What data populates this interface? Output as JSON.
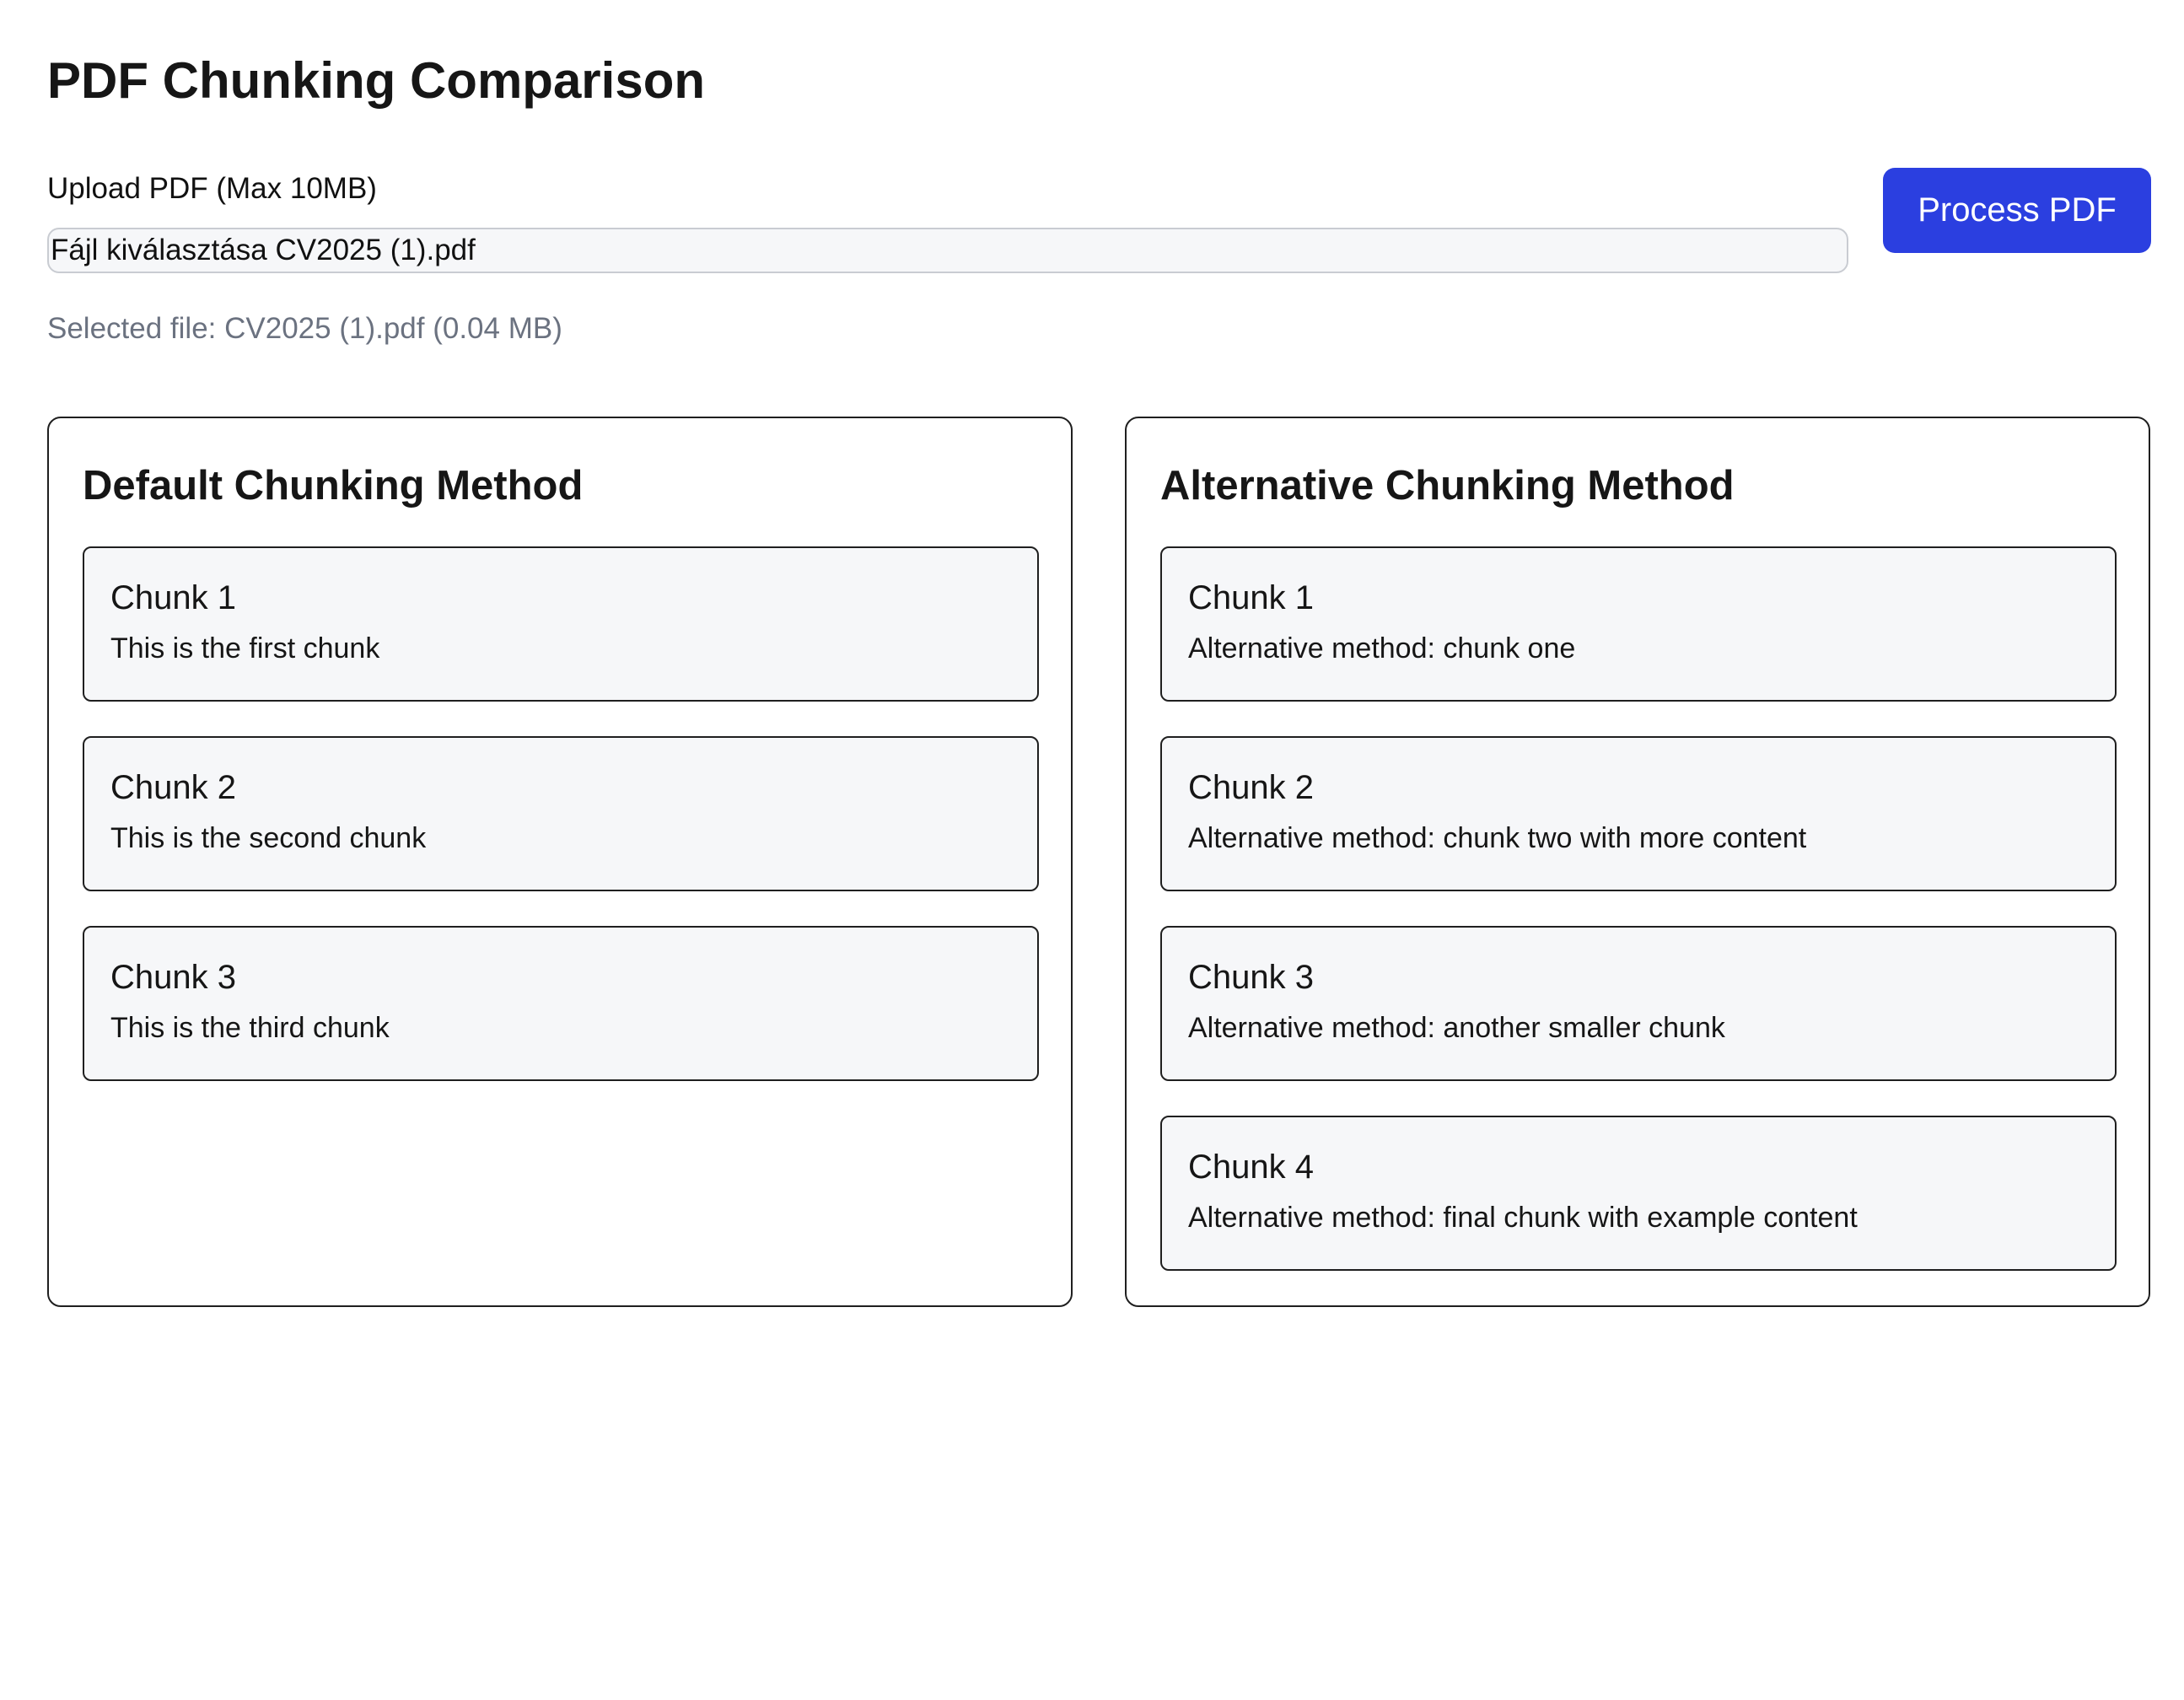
{
  "header": {
    "title": "PDF Chunking Comparison"
  },
  "upload": {
    "label": "Upload PDF (Max 10MB)",
    "file_input_text": "Fájl kiválasztása CV2025 (1).pdf",
    "selected_file_text": "Selected file: CV2025 (1).pdf (0.04 MB)",
    "process_button_label": "Process PDF",
    "button_color": "#2b3fe0"
  },
  "panels": {
    "default": {
      "title": "Default Chunking Method",
      "chunks": [
        {
          "title": "Chunk 1",
          "text": "This is the first chunk"
        },
        {
          "title": "Chunk 2",
          "text": "This is the second chunk"
        },
        {
          "title": "Chunk 3",
          "text": "This is the third chunk"
        }
      ]
    },
    "alternative": {
      "title": "Alternative Chunking Method",
      "chunks": [
        {
          "title": "Chunk 1",
          "text": "Alternative method: chunk one"
        },
        {
          "title": "Chunk 2",
          "text": "Alternative method: chunk two with more content"
        },
        {
          "title": "Chunk 3",
          "text": "Alternative method: another smaller chunk"
        },
        {
          "title": "Chunk 4",
          "text": "Alternative method: final chunk with example content"
        }
      ]
    }
  }
}
